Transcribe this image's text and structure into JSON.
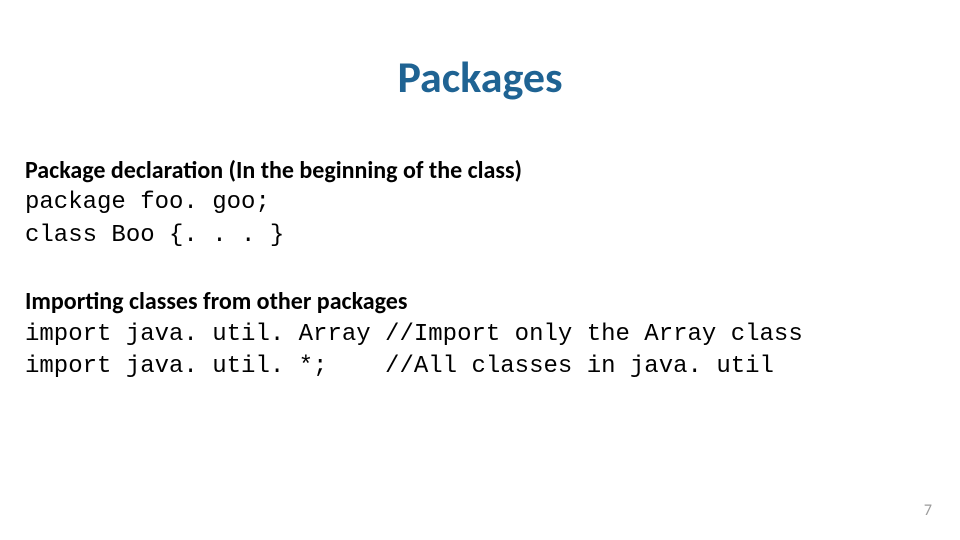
{
  "title": "Packages",
  "section1": {
    "heading": "Package declaration (In the beginning of the class)",
    "line1": "package foo. goo;",
    "line2": "class Boo {. . . }"
  },
  "section2": {
    "heading": "Importing classes from other packages",
    "line1": "import java. util. Array //Import only the Array class",
    "line2": "import java. util. *;    //All classes in java. util"
  },
  "page_number": "7"
}
